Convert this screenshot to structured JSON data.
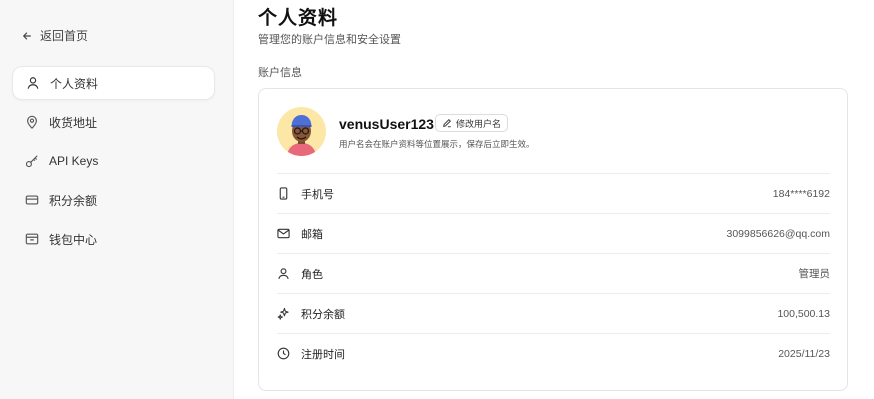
{
  "sidebar": {
    "back_label": "返回首页",
    "items": [
      {
        "label": "个人资料",
        "icon": "user-icon",
        "active": true
      },
      {
        "label": "收货地址",
        "icon": "map-pin-icon",
        "active": false
      },
      {
        "label": "API Keys",
        "icon": "key-icon",
        "active": false
      },
      {
        "label": "积分余额",
        "icon": "credit-card-icon",
        "active": false
      },
      {
        "label": "钱包中心",
        "icon": "wallet-icon",
        "active": false
      }
    ]
  },
  "header": {
    "title": "个人资料",
    "subtitle": "管理您的账户信息和安全设置"
  },
  "account": {
    "section_label": "账户信息",
    "username": "venusUser123",
    "edit_label": "修改用户名",
    "hint": "用户名会在账户资料等位置展示，保存后立即生效。",
    "rows": [
      {
        "label": "手机号",
        "value": "184****6192",
        "icon": "phone-icon"
      },
      {
        "label": "邮箱",
        "value": "3099856626@qq.com",
        "icon": "mail-icon"
      },
      {
        "label": "角色",
        "value": "管理员",
        "icon": "user-icon"
      },
      {
        "label": "积分余额",
        "value": "100,500.13",
        "icon": "sparkles-icon"
      },
      {
        "label": "注册时间",
        "value": "2025/11/23",
        "icon": "clock-icon"
      }
    ]
  },
  "colors": {
    "sidebar_bg": "#f7f7f7",
    "avatar_bg": "#fde7a6",
    "avatar_hat": "#4f6fd8"
  }
}
